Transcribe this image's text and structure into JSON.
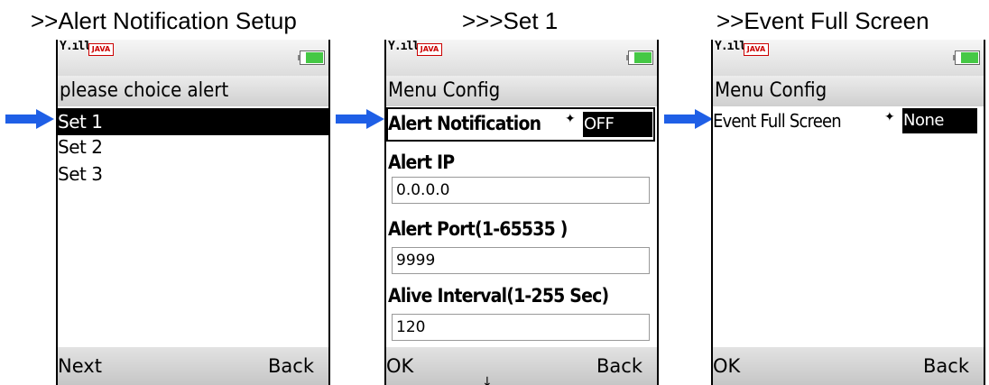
{
  "screens": [
    {
      "title": ">>Alert Notification Setup",
      "header": "please choice alert",
      "items": [
        "Set 1",
        "Set 2",
        "Set 3"
      ],
      "selected_index": 0,
      "softkey_left": "Next",
      "softkey_right": "Back"
    },
    {
      "title": ">>>Set 1",
      "header": "Menu Config",
      "alert_notification": {
        "label": "Alert Notification",
        "value": "OFF"
      },
      "alert_ip": {
        "label": "Alert IP",
        "value": "0.0.0.0"
      },
      "alert_port": {
        "label": "Alert Port(1-65535 )",
        "value": "9999"
      },
      "alive_interval": {
        "label": "Alive Interval(1-255 Sec)",
        "value": "120"
      },
      "softkey_left": "OK",
      "softkey_center": "↓",
      "softkey_right": "Back"
    },
    {
      "title": ">>Event Full Screen",
      "header": "Menu Config",
      "event_full_screen": {
        "label": "Event Full Screen",
        "value": "None"
      },
      "softkey_left": "OK",
      "softkey_right": "Back"
    }
  ],
  "status": {
    "java_badge": "JAVA",
    "signal": "Y.ıll"
  },
  "colors": {
    "arrow": "#1f5fe6",
    "battery": "#45c845",
    "selection": "#000000"
  }
}
